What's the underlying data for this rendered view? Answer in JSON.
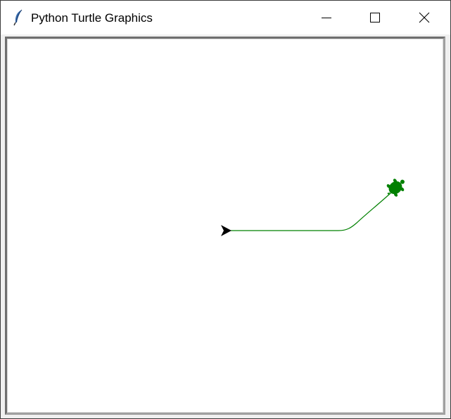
{
  "window": {
    "title": "Python Turtle Graphics",
    "app_icon": "tk-feather-icon",
    "buttons": {
      "minimize": "minimize-icon",
      "maximize": "maximize-icon",
      "close": "close-icon"
    }
  },
  "canvas": {
    "background": "#ffffff",
    "pen_color": "#008000",
    "turtles": [
      {
        "shape": "classic-arrow",
        "color": "#000000",
        "heading": "east"
      },
      {
        "shape": "turtle",
        "color": "#008000"
      }
    ]
  }
}
